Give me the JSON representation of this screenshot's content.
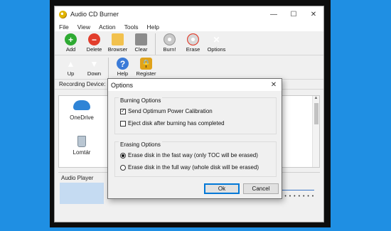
{
  "window": {
    "title": "Audio CD Burner",
    "controls": [
      "—",
      "☐",
      "✕"
    ]
  },
  "menu": [
    "File",
    "View",
    "Action",
    "Tools",
    "Help"
  ],
  "toolbar_row1": [
    {
      "label": "Add",
      "icon": "add-icon",
      "glyph": "+"
    },
    {
      "label": "Delete",
      "icon": "delete-icon",
      "glyph": "−"
    },
    {
      "label": "Browser",
      "icon": "folder-icon",
      "glyph": ""
    },
    {
      "label": "Clear",
      "icon": "clear-icon",
      "glyph": ""
    },
    {
      "label": "Burn!",
      "icon": "disc-burn-icon",
      "glyph": ""
    },
    {
      "label": "Erase",
      "icon": "disc-erase-icon",
      "glyph": ""
    },
    {
      "label": "Options",
      "icon": "tools-icon",
      "glyph": "✕"
    }
  ],
  "toolbar_row2": [
    {
      "label": "Up",
      "icon": "arrow-up-icon",
      "glyph": "▲"
    },
    {
      "label": "Down",
      "icon": "arrow-down-icon",
      "glyph": "▼"
    },
    {
      "label": "Help",
      "icon": "help-icon",
      "glyph": "?"
    },
    {
      "label": "Register",
      "icon": "lock-icon",
      "glyph": "🔒"
    }
  ],
  "recording_device_label": "Recording Device:",
  "files": [
    {
      "name": "OneDrive",
      "icon": "onedrive-icon"
    },
    {
      "name": "Lomtár",
      "icon": "recycle-bin-icon"
    }
  ],
  "audio_player": {
    "title": "Audio Player",
    "dots": "• • • • • • • •"
  },
  "dialog": {
    "title": "Options",
    "close": "✕",
    "burning": {
      "title": "Burning Options",
      "options": [
        {
          "label": "Send Optimum Power Calibration",
          "checked": true
        },
        {
          "label": "Eject disk after burning has completed",
          "checked": false
        }
      ]
    },
    "erasing": {
      "title": "Erasing Options",
      "options": [
        {
          "label": "Erase disk in the fast way (only TOC will be erased)",
          "selected": true
        },
        {
          "label": "Erase disk in the full way (whole disk will be erased)",
          "selected": false
        }
      ]
    },
    "ok_label": "Ok",
    "cancel_label": "Cancel"
  },
  "colors": {
    "background": "#1f8fe3",
    "accent": "#0078d7",
    "audio_visual": "#c5dbf2"
  }
}
